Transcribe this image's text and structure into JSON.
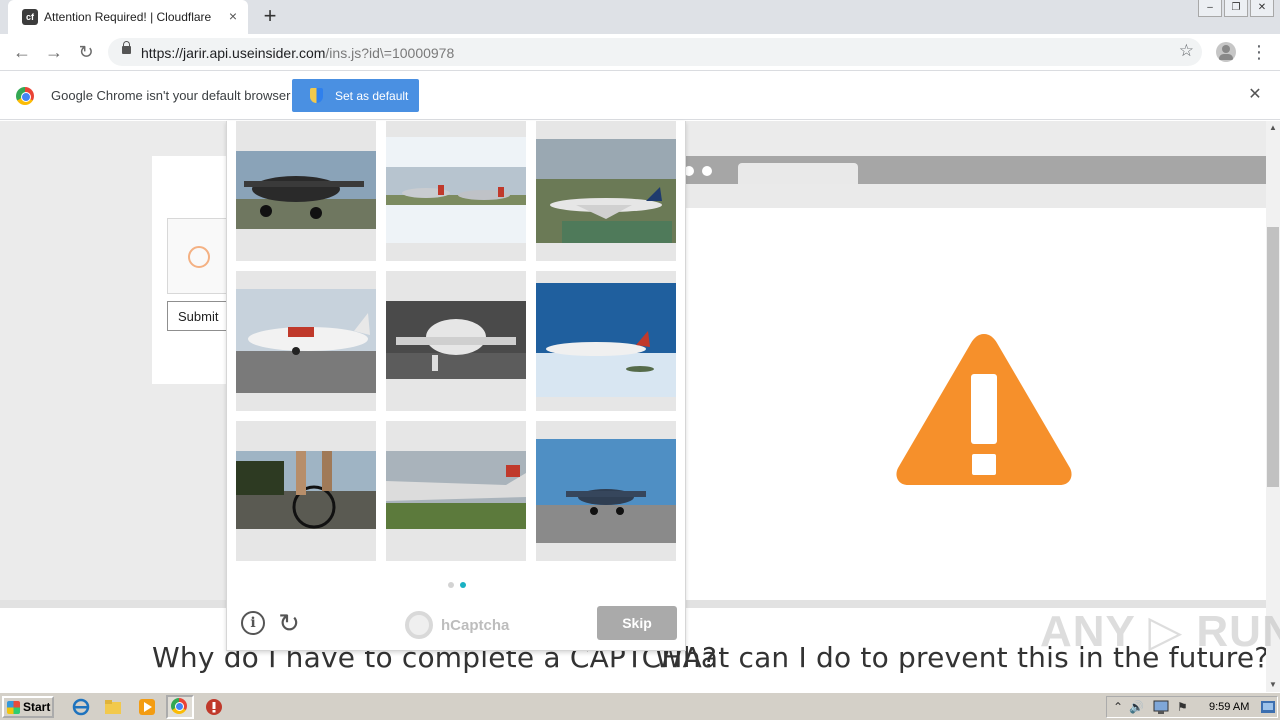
{
  "tab": {
    "title": "Attention Required! | Cloudflare",
    "favicon": "cf-favicon",
    "close": "×"
  },
  "newtab": {
    "label": "+"
  },
  "window_controls": {
    "minimize": "–",
    "restore": "❐",
    "close": "✕"
  },
  "nav": {
    "back": "←",
    "forward": "→",
    "reload": "↻"
  },
  "address": {
    "url_host": "https://jarir.api.useinsider.com",
    "url_path": "/ins.js?id\\=10000978",
    "bookmark": "☆"
  },
  "menu": {
    "dots": "⋮"
  },
  "infobar": {
    "message": "Google Chrome isn't your default browser",
    "button_label": "Set as default",
    "close": "✕"
  },
  "page": {
    "submit_label": "Submit",
    "heading_left": "Why do I have to complete a CAPTCHA?",
    "heading_right": "What can I do to prevent this in the future?"
  },
  "captcha": {
    "images": [
      "airplane",
      "airplane",
      "airplane",
      "airplane",
      "airplane",
      "airplane",
      "bicycle",
      "airplane",
      "airplane"
    ],
    "pages": 2,
    "current_page": 2,
    "brand": "hCaptcha",
    "skip_label": "Skip",
    "info_icon": "i",
    "refresh_icon": "↻",
    "accent_color": "#1ab1c3"
  },
  "watermark": {
    "text": "ANY ▷ RUN"
  },
  "scrollbar": {
    "up": "▲",
    "down": "▼"
  },
  "taskbar": {
    "start_label": "Start",
    "tray_arrow": "⌃",
    "tray_volume": "🔊",
    "tray_flag": "⚑",
    "clock": "9:59 AM"
  },
  "colors": {
    "warning_orange": "#f6902b",
    "chrome_button": "#4a90e2"
  }
}
